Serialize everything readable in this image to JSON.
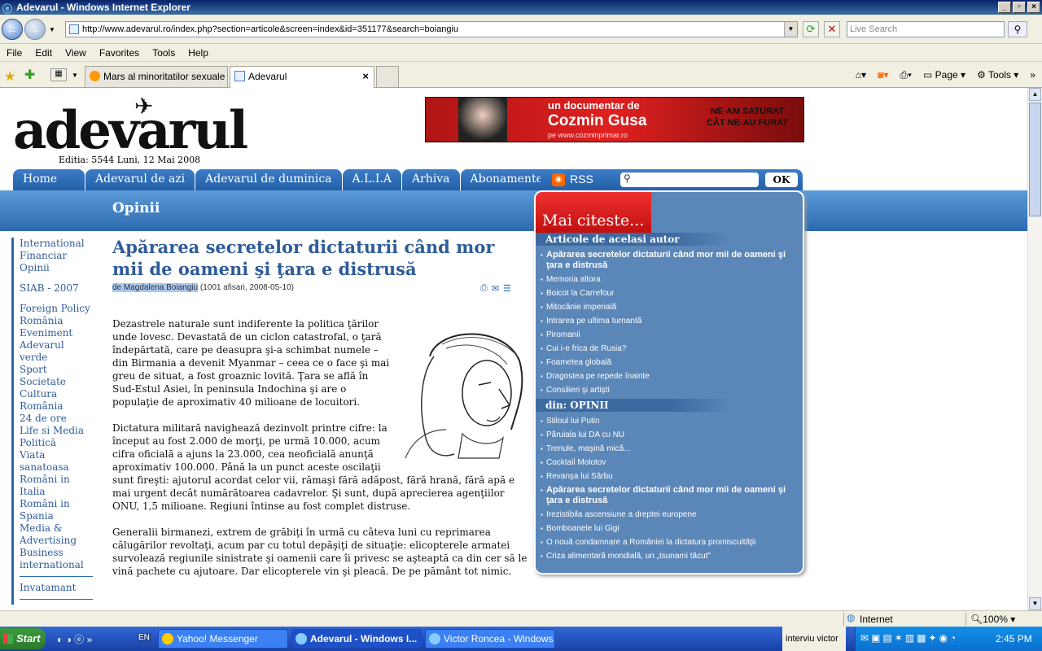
{
  "window": {
    "title": "Adevarul - Windows Internet Explorer",
    "controls": [
      "_",
      "▫",
      "×"
    ]
  },
  "nav": {
    "back": "←",
    "forward": "→",
    "url": "http://www.adevarul.ro/index.php?section=articole&screen=index&id=351177&search=boiangiu",
    "search_placeholder": "Live Search"
  },
  "menu": [
    "File",
    "Edit",
    "View",
    "Favorites",
    "Tools",
    "Help"
  ],
  "tabs": [
    {
      "label": "Mars al minoritatilor sexuale l..."
    },
    {
      "label": "Adevarul"
    }
  ],
  "commands": [
    "Page",
    "Tools"
  ],
  "site": {
    "logo": "adevarul",
    "edition": "Editia: 5544 Luni, 12 Mai 2008",
    "banner": {
      "line1": "un documentar de",
      "line2": "Cozmin Gusa",
      "line3": "pe www.cozminprimar.ro",
      "slogan": "NE-AM SATURAT CÂT NE-AU FURAT"
    },
    "nav": [
      "Home",
      "Adevarul de azi",
      "Adevarul de duminica",
      "A.L.I.A",
      "Arhiva",
      "Abonamente"
    ],
    "rss": "RSS",
    "ok": "OK",
    "section": "Opinii"
  },
  "leftnav": {
    "group1": [
      "International",
      "Financiar",
      "Opinii"
    ],
    "group2": [
      "SIAB - 2007"
    ],
    "group3": [
      "Foreign Policy România",
      "Eveniment",
      "Adevarul verde",
      "Sport",
      "Societate",
      "Cultura",
      "România",
      "24 de ore",
      "Life si Media",
      "Politică",
      "Viata sanatoasa",
      "Români in Italia",
      "Români in Spania",
      "Media & Advertising",
      "Business international"
    ],
    "group4": [
      "Invatamant"
    ]
  },
  "article": {
    "title": "Apărarea secretelor dictaturii când mor mii de oameni şi ţara e distrusă",
    "byline_author": "de Magdalena Boiangiu",
    "byline_meta": " (1001 afisari, 2008-05-10)",
    "paragraphs": [
      "Dezastrele naturale sunt indiferente la politica ţărilor unde lovesc. Devastată de un ciclon catastrofal, o ţară îndepărtată, care pe deasupra şi-a schimbat numele – din Birmania a devenit Myanmar – ceea ce o face şi mai greu de situat, a fost groaznic lovită. Ţara se află în Sud-Estul Asiei, în peninsula Indochina şi are o populaţie de aproximativ 40 milioane de locuitori.",
      "Dictatura militară navighează dezinvolt printre cifre: la început au fost 2.000 de morţi, pe urmă 10.000, acum cifra oficială a ajuns la 23.000, cea neoficială anunţă aproximativ 100.000. Până la un punct aceste oscilaţii sunt fireşti: ajutorul acordat celor vii, rămaşi fără adăpost, fără hrană, fără apă e mai urgent decât numărătoarea cadavrelor. Şi sunt, după aprecierea agenţiilor ONU, 1,5 milioane. Regiuni întinse au fost complet distruse.",
      "Generalii birmanezi, extrem de grăbiţi în urmă cu câteva luni cu reprimarea călugărilor revoltaţi, acum par cu totul depăşiţi de situaţie: elicopterele armatei survolează regiunile sinistrate şi oamenii care îi privesc se aşteaptă ca din cer să le vină pachete cu ajutoare. Dar elicopterele vin şi pleacă. De pe pământ tot nimic."
    ]
  },
  "sidebar": {
    "header": "Mai citeste...",
    "author_title": "Articole de acelasi autor",
    "author_items": [
      "Apărarea secretelor dictaturii când mor mii de oameni şi ţara e distrusă",
      "Memoria altora",
      "Boicot la Carrefour",
      "Mitocănie imperială",
      "Intrarea pe ultima turnantă",
      "Piromanii",
      "Cui i-e frica de Rusia?",
      "Foametea globală",
      "Dragostea pe repede înainte",
      "Consilieri şi artişti"
    ],
    "section_title": "din: OPINII",
    "section_items": [
      "Stiloul lui Putin",
      "Păruiala lui DA cu NU",
      "Trenule, maşină mică...",
      "Cocktail Molotov",
      "Revanşa lui Sârbu",
      "Apărarea secretelor dictaturii când mor mii de oameni şi ţara e distrusă",
      "Irezistibila ascensiune a dreptei europene",
      "Bomboanele lui Gigi",
      "O nouă condamnare a României la dictatura promiscuităţii",
      "Criza alimentară mondială, un „tsunami tăcut\""
    ]
  },
  "status": {
    "zone": "Internet",
    "zoom": "100%"
  },
  "taskbar": {
    "start": "Start",
    "tasks": [
      "Yahoo! Messenger",
      "Adevarul - Windows I...",
      "Victor Roncea - Windows..."
    ],
    "lang": "EN",
    "tray_text": "interviu victor",
    "clock": "2:45 PM"
  }
}
